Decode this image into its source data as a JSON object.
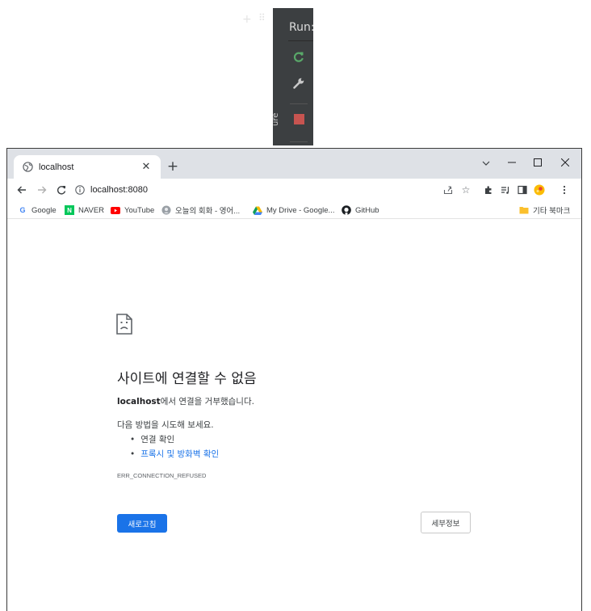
{
  "ide": {
    "run_label": "Run:",
    "vertical_label": "ure"
  },
  "browser": {
    "tab": {
      "title": "localhost"
    },
    "address_bar": {
      "url": "localhost:8080"
    },
    "bookmarks": [
      {
        "label": "Google",
        "icon": "google-icon"
      },
      {
        "label": "NAVER",
        "icon": "naver-icon"
      },
      {
        "label": "YouTube",
        "icon": "youtube-icon"
      },
      {
        "label": "오늘의 회화 - 영어...",
        "icon": "podcast-icon"
      },
      {
        "label": "My Drive - Google...",
        "icon": "drive-icon"
      },
      {
        "label": "GitHub",
        "icon": "github-icon"
      }
    ],
    "other_bookmarks": {
      "label": "기타 북마크",
      "icon": "folder-icon"
    }
  },
  "error_page": {
    "title": "사이트에 연결할 수 없음",
    "host": "localhost",
    "message_suffix": "에서 연결을 거부했습니다.",
    "suggestions_heading": "다음 방법을 시도해 보세요.",
    "suggestions": [
      {
        "label": "연결 확인",
        "link": false
      },
      {
        "label": "프록시 및 방화벽 확인",
        "link": true
      }
    ],
    "error_code": "ERR_CONNECTION_REFUSED",
    "reload_label": "새로고침",
    "details_label": "세부정보"
  },
  "colors": {
    "ide_background": "#3c3f41",
    "browser_frame": "#dee1e6",
    "primary_button": "#1a73e8",
    "link": "#1a73e8",
    "stop_button": "#c75450",
    "rerun_icon": "#59a869"
  }
}
